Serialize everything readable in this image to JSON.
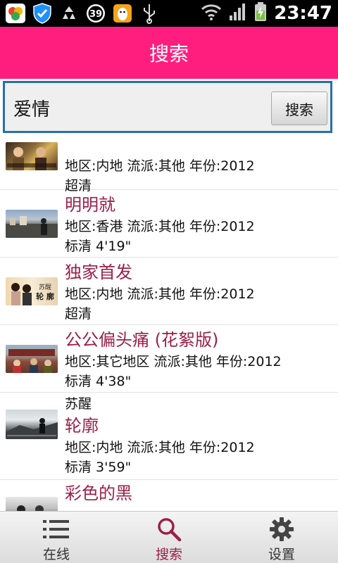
{
  "status_bar": {
    "icons": [
      "app-store-icon",
      "shield-icon",
      "recycle-icon",
      "badge-39-icon",
      "qq-icon",
      "usb-icon",
      "wifi-icon",
      "signal-icon",
      "battery-charging-icon"
    ],
    "badge_count": "39",
    "time": "23:47"
  },
  "header": {
    "title": "搜索"
  },
  "search": {
    "value": "爱情",
    "button_label": "搜索"
  },
  "results": [
    {
      "pre": "",
      "title": "",
      "meta": "地区:内地  流派:其他  年份:2012",
      "quality": "超清"
    },
    {
      "pre": "",
      "title": "明明就",
      "meta": "地区:香港  流派:其他  年份:2012",
      "quality": "标清  4'19\""
    },
    {
      "pre": "",
      "title": "独家首发",
      "meta": "地区:内地  流派:其他  年份:2012",
      "quality": "超清"
    },
    {
      "pre": "",
      "title": "公公偏头痛 (花絮版)",
      "meta": "地区:其它地区  流派:其他  年份:2012",
      "quality": "标清  4'38\""
    },
    {
      "pre": "苏醒",
      "title": "轮廓",
      "meta": "地区:内地  流派:其他  年份:2012",
      "quality": "标清  3'59\""
    },
    {
      "pre": "",
      "title": "彩色的黑",
      "meta": "",
      "quality": ""
    }
  ],
  "thumb_text": {
    "item2_line1": "苏醒",
    "item2_line2": "轮 廓"
  },
  "tabs": [
    {
      "label": "在线",
      "icon": "list-icon",
      "active": false
    },
    {
      "label": "搜索",
      "icon": "search-icon",
      "active": true
    },
    {
      "label": "设置",
      "icon": "gear-icon",
      "active": false
    }
  ],
  "colors": {
    "title_bar": "#ff1e7e",
    "title_text": "#9b2048",
    "search_border": "#2a6fa8"
  }
}
